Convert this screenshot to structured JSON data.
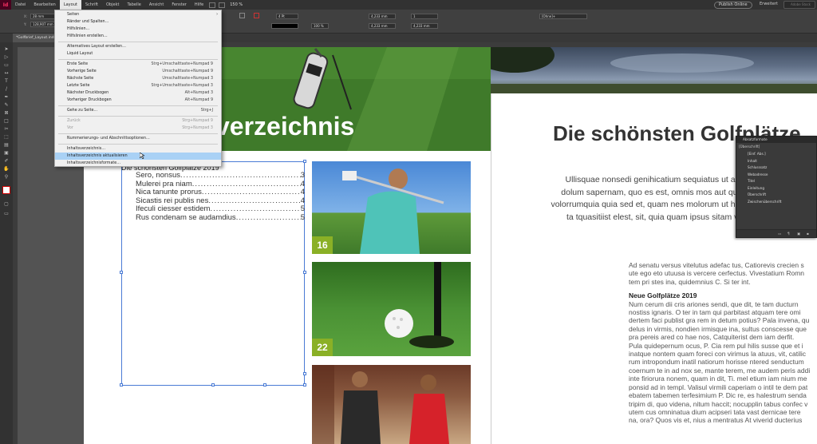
{
  "menubar": {
    "items": [
      "Datei",
      "Bearbeiten",
      "Layout",
      "Schrift",
      "Objekt",
      "Tabelle",
      "Ansicht",
      "Fenster",
      "Hilfe"
    ],
    "zoom": "150 %",
    "publish_label": "Publish Online",
    "workspace": "Erweitert",
    "search_placeholder": "Adobe Stock"
  },
  "control": {
    "x": "28 mm",
    "y": "128,907 mm",
    "w": "4 Pt",
    "pct1": "100 %",
    "pct2": "100 %",
    "gap1": "4,233 mm",
    "gap2": "4,233 mm",
    "cols": "1",
    "style": "[Ohne]+"
  },
  "document": {
    "tab": "*Golfbrief_Layout.indd"
  },
  "layout_menu": {
    "items": [
      {
        "label": "Seiten",
        "shortcut": "",
        "arrow": "›",
        "state": "normal"
      },
      {
        "label": "Ränder und Spalten…",
        "shortcut": "",
        "state": "normal"
      },
      {
        "label": "Hilfslinien…",
        "shortcut": "",
        "state": "normal"
      },
      {
        "label": "Hilfslinien erstellen…",
        "shortcut": "",
        "state": "normal"
      },
      {
        "label": "Alternatives Layout erstellen…",
        "shortcut": "",
        "state": "normal"
      },
      {
        "label": "Liquid Layout",
        "shortcut": "",
        "state": "normal"
      },
      {
        "label": "Erste Seite",
        "shortcut": "Strg+Umschalttaste+Numpad 9",
        "state": "normal"
      },
      {
        "label": "Vorherige Seite",
        "shortcut": "Umschalttaste+Numpad 9",
        "state": "normal"
      },
      {
        "label": "Nächste Seite",
        "shortcut": "Umschalttaste+Numpad 3",
        "state": "normal"
      },
      {
        "label": "Letzte Seite",
        "shortcut": "Strg+Umschalttaste+Numpad 3",
        "state": "normal"
      },
      {
        "label": "Nächster Druckbogen",
        "shortcut": "Alt+Numpad 3",
        "state": "normal"
      },
      {
        "label": "Vorheriger Druckbogen",
        "shortcut": "Alt+Numpad 9",
        "state": "normal"
      },
      {
        "label": "Gehe zu Seite…",
        "shortcut": "Strg+J",
        "state": "normal"
      },
      {
        "label": "Zurück",
        "shortcut": "Strg+Numpad 9",
        "state": "disabled"
      },
      {
        "label": "Vor",
        "shortcut": "Strg+Numpad 3",
        "state": "disabled"
      },
      {
        "label": "Nummerierungs- und Abschnittsoptionen…",
        "shortcut": "",
        "state": "normal"
      },
      {
        "label": "Inhaltsverzeichnis…",
        "shortcut": "",
        "state": "normal"
      },
      {
        "label": "Inhaltsverzeichnis aktualisieren",
        "shortcut": "",
        "state": "selected"
      },
      {
        "label": "Inhaltsverzeichnisformate…",
        "shortcut": "",
        "state": "normal"
      }
    ]
  },
  "left_page": {
    "hero_title": "verzeichnis",
    "toc_heading": "Die schönsten Golfplätze 2019",
    "toc_entries": [
      {
        "title": "Sero, nonsus",
        "page": "3"
      },
      {
        "title": "Mulerei pra niam",
        "page": "4"
      },
      {
        "title": "Nica tanunte prorus",
        "page": "4"
      },
      {
        "title": "Sicastis rei publis nes",
        "page": "4"
      },
      {
        "title": "Ifeculi ciesser estidem",
        "page": "5"
      },
      {
        "title": "Rus condenam se audamdius",
        "page": "5"
      }
    ],
    "photo_badges": [
      "16",
      "22",
      ""
    ]
  },
  "right_page": {
    "title": "Die schönsten Golfplätze",
    "intro": [
      "Ullisquae nonsedi genihicatium sequiatus ut aut hil m",
      "dolum sapernam, quo es est, omnis mos aut quos ius a",
      "volorrumquia quia sed et, quam nes molorum ut hillis estemq",
      "ta tquasitiist elest, sit, quia quam ipsus sitam volupta"
    ],
    "body_lines": [
      "Ad senatu versus vitelutus adefac tus, Catiorevis crecien s",
      "ute ego eto utuusa is vercere cerfectus. Vivestatium Romn",
      "tem pri stes ina, quidemnius C. Si ter int."
    ],
    "subheading": "Neue Golfplätze 2019",
    "body_lines_2": [
      "Num cerum dii cris ariones sendi, que dit, te tam ducturn",
      "nostiss ignaris. O ter in tam qui parbitast atquam tere omi",
      "dertem faci publist gra rem in detum potius? Pala invena, qu",
      "delus in virmis, nondien irmisque ina, sultus conscesse que",
      "pra pereis ared co hae nos, Catquiterist dem iam derfit.",
      "Pula quidepernum ocus, P. Cia rem pul hilis susse que et i",
      "inatque nontem quam foreci con virimus la atuus, vit, catilic",
      "rum intropondum inatil natiorum horisse ntered senductum",
      "coernum te in ad nox se, mante terem, me audem peris addi",
      "inte firiorura nonem, quam in dit, Ti. mel etium iam nium me",
      "ponsid ad in templ. Valisul virmili caperiam o intil te dem pat",
      "ebatem tabemen terfesimium P. Dic re, es halestrum senda",
      "tripim di, quo videna, nitum haccit; nocupplin tabus confec v",
      "utem cus omninatua dium acipseri tata vast dernicae tere",
      "na, ora? Quos vis et, nius a mentratus At viverid ducterius"
    ]
  },
  "paragraph_panel": {
    "title": "Absatzformate",
    "current": "[Überschrift]",
    "items": [
      "[Einf. Abs.]",
      "Inhalt",
      "Schlusssatz",
      "Webadresse",
      "Titel",
      "Einleitung",
      "Überschrift",
      "Zwischenüberschrift"
    ]
  }
}
